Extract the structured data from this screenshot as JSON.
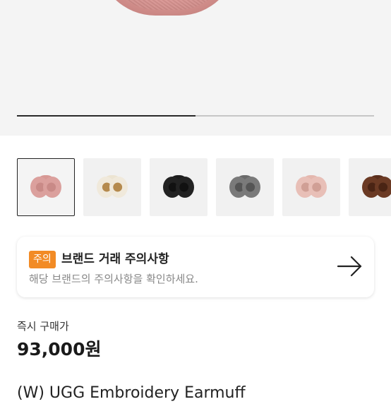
{
  "gallery": {
    "progress_fraction": 0.5,
    "thumbnails": [
      {
        "name": "thumbnail-1",
        "band": "#d79894",
        "cup": "#dba09d",
        "accent": "#c98a87",
        "selected": true
      },
      {
        "name": "thumbnail-2",
        "band": "#ece4d2",
        "cup": "#f0e9db",
        "accent": "#b58a4e",
        "selected": false
      },
      {
        "name": "thumbnail-3",
        "band": "#1c1c1c",
        "cup": "#222222",
        "accent": "#111111",
        "selected": false
      },
      {
        "name": "thumbnail-4",
        "band": "#6a6a6a",
        "cup": "#7a7a7a",
        "accent": "#555555",
        "selected": false
      },
      {
        "name": "thumbnail-5",
        "band": "#e4b7ae",
        "cup": "#e8bfb7",
        "accent": "#d09f95",
        "selected": false
      },
      {
        "name": "thumbnail-6",
        "band": "#5a2e1c",
        "cup": "#6b3a24",
        "accent": "#4a2414",
        "selected": false
      }
    ]
  },
  "notice": {
    "badge": "주의",
    "title": "브랜드 거래 주의사항",
    "subtitle": "해당 브랜드의 주의사항을 확인하세요."
  },
  "price": {
    "label": "즉시 구매가",
    "value": "93,000원"
  },
  "product": {
    "title": "(W) UGG Embroidery Earmuff"
  }
}
